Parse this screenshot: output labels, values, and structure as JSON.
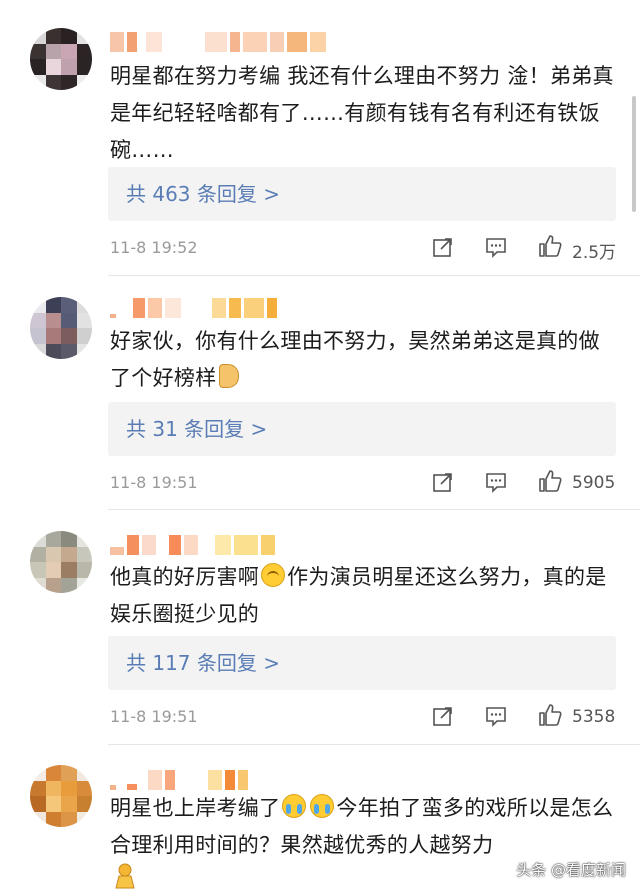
{
  "comments": [
    {
      "text": "明星都在努力考编 我还有什么理由不努力 淦！弟弟真是年纪轻轻啥都有了……有颜有钱有名有利还有铁饭碗……",
      "replies_label": "共 463 条回复 >",
      "time": "11-8 19:52",
      "likes": "2.5万"
    },
    {
      "text_before": "好家伙，你有什么理由不努力，昊然弟弟这是真的做了个好榜样",
      "emoji": "thumbs-up",
      "replies_label": "共 31 条回复 >",
      "time": "11-8 19:51",
      "likes": "5905"
    },
    {
      "text_before": "他真的好厉害啊",
      "emoji": "eye-roll",
      "text_after": "作为演员明星还这么努力，真的是娱乐圈挺少见的",
      "replies_label": "共 117 条回复 >",
      "time": "11-8 19:51",
      "likes": "5358"
    },
    {
      "text_before": "明星也上岸考编了",
      "emojis": [
        "crying-face",
        "crying-face"
      ],
      "text_after": "今年拍了蛮多的戏所以是怎么合理利用时间的？果然越优秀的人越努力"
    }
  ],
  "watermark": "头条 @看度新闻",
  "colors": {
    "reply_link": "#5a7db5",
    "reply_box": "#f3f3f3",
    "time": "#9a9a9a",
    "divider": "#e6e6e6"
  }
}
